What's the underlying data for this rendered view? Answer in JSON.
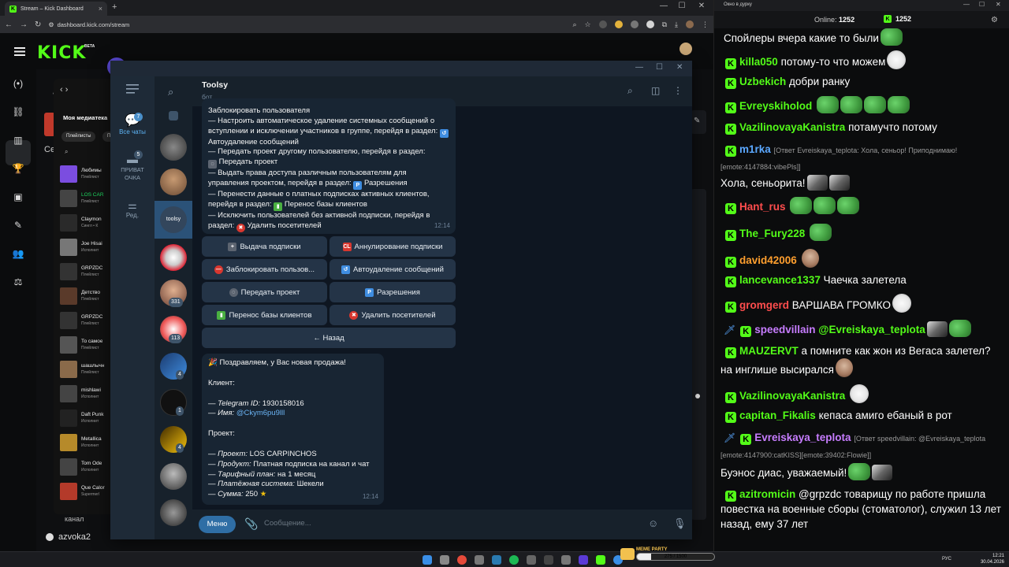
{
  "browser": {
    "tab_title": "Stream – Kick Dashboard",
    "url": "dashboard.kick.com/stream",
    "logo": "KICK",
    "logo_badge": "BETA",
    "bottom_label": "канал",
    "bottom_user": "azvoka2",
    "side_label": "Се"
  },
  "music": {
    "title": "Моя медиатека",
    "chips": [
      "Плейлисты",
      "Плейл"
    ],
    "items": [
      {
        "title": "Любимы",
        "sub": "Плейлист"
      },
      {
        "title": "LOS CAR",
        "sub": "Плейлист"
      },
      {
        "title": "Claymon",
        "sub": "Сингл • К"
      },
      {
        "title": "Joe Hisai",
        "sub": "Исполнит"
      },
      {
        "title": "GRPZDC",
        "sub": "Плейлист"
      },
      {
        "title": "Детство",
        "sub": "Плейлист"
      },
      {
        "title": "GRPZDC",
        "sub": "Плейлист"
      },
      {
        "title": "То самое",
        "sub": "Плейлист"
      },
      {
        "title": "шашлычн",
        "sub": "Плейлист"
      },
      {
        "title": "mishlawi",
        "sub": "Исполнит"
      },
      {
        "title": "Daft Punk",
        "sub": "Исполнит"
      },
      {
        "title": "Metallica",
        "sub": "Исполнит"
      },
      {
        "title": "Tom Ode",
        "sub": "Исполнит"
      },
      {
        "title": "Que Calor",
        "sub": "Supermerl"
      }
    ]
  },
  "telegram": {
    "window_title": "LOS CARPINCHOS",
    "folders": [
      {
        "label": "Все чаты",
        "badge": "7"
      },
      {
        "label": "ПРИВАТ ОЧКА",
        "badge": "5"
      },
      {
        "label": "Ред.",
        "badge": ""
      }
    ],
    "active_chat_label": "toolsy",
    "chat_badges": [
      "331",
      "113",
      "4",
      "1",
      "4"
    ],
    "header": {
      "name": "Toolsy",
      "status": "бот"
    },
    "msg1": {
      "lines": [
        "Заблокировать пользователя",
        "— Настроить автоматическое удаление системных сообщений о вступлении и исключении участников в группе, перейдя в раздел: ",
        "Автоудаление сообщений",
        "— Передать проект другому пользователю, перейдя в раздел:",
        "Передать проект",
        "— Выдать права доступа различным пользователям для управления проектом, перейдя в раздел: ",
        "Разрешения",
        "— Перенести данные о платных подписках активных клиентов, перейдя в раздел: ",
        "Перенос базы клиентов",
        "— Исключить пользователей без активной подписки, перейдя в раздел: ",
        "Удалить посетителей"
      ],
      "time": "12:14"
    },
    "keyboard": {
      "b1": "Выдача подписки",
      "b2": "Аннулирование подписки",
      "b3": "Заблокировать пользов...",
      "b4": "Автоудаление сообщений",
      "b5": "Передать проект",
      "b6": "Разрешения",
      "b7": "Перенос базы клиентов",
      "b8": "Удалить посетителей",
      "back": "← Назад"
    },
    "msg2": {
      "congrats": "Поздравляем, у Вас новая продажа!",
      "client_h": "Клиент:",
      "tg_id_label": "— Telegram ID:",
      "tg_id": "1930158016",
      "name_label": "— Имя:",
      "name": "@Ckym6pu9lll",
      "project_h": "Проект:",
      "project_label": "— Проект:",
      "project": "LOS CARPINCHOS",
      "product_label": "— Продукт:",
      "product": "Платная подписка на канал и чат",
      "plan_label": "— Тарифный план:",
      "plan": "на 1 месяц",
      "pay_label": "— Платёжная система:",
      "pay": "Шекели",
      "sum_label": "— Сумма:",
      "sum": "250",
      "time": "12:14"
    },
    "input": {
      "menu": "Меню",
      "placeholder": "Сообщение..."
    }
  },
  "kick_chat": {
    "window_title": "Окно в дурку",
    "online_label": "Online:",
    "online": "1252",
    "viewers": "1252",
    "messages": [
      {
        "user": "",
        "text": "Спойлеры вчера какие то были"
      },
      {
        "user": "killa050",
        "text": "потому-то что можем"
      },
      {
        "user": "Uzbekich",
        "text": "добри ранку"
      },
      {
        "user": "Evreyskiholod",
        "text": ""
      },
      {
        "user": "VazilinovayaKanistra",
        "text": "потамучто потому"
      },
      {
        "user": "m1rka",
        "reply": "[Ответ Evreiskaya_teplota: Хола, сеньор! Приподнимаю! [emote:4147884:vibePls]]",
        "text": "Хола, сеньорита!"
      },
      {
        "user": "Hant_rus",
        "text": ""
      },
      {
        "user": "The_Fury228",
        "text": ""
      },
      {
        "user": "david42006",
        "text": ""
      },
      {
        "user": "lancevance1337",
        "text": "Чаечка залетела"
      },
      {
        "user": "gromgerd",
        "text": "ВАРШАВА ГРОМКО"
      },
      {
        "user": "speedvillain",
        "text": "@Evreiskaya_teplota"
      },
      {
        "user": "MAUZERVT",
        "text": "а помните как жон из Вегаса залетел? на инглише высирался"
      },
      {
        "user": "VazilinovayaKanistra",
        "text": ""
      },
      {
        "user": "capitan_Fikalis",
        "text": "кепаса амиго ебаный в рот"
      },
      {
        "user": "Evreiskaya_teplota",
        "reply": "[Ответ speedvillain: @Evreiskaya_teplota [emote:4147900:catKISS][emote:39402:Flowie]]",
        "text": "Буэнос диас, уважаемый!"
      },
      {
        "user": "azitromicin",
        "text": "@grpzdc товарищу по работе пришла повестка на военные сборы (стоматолог), служил 13 лет назад, ему 37 лет"
      }
    ]
  },
  "taskbar": {
    "lang": "РУС",
    "time": "12:21",
    "date": "30.04.2026",
    "meme_label": "MEME PARTY",
    "meme_progress": "275 / 1500"
  },
  "colors": {
    "kick_green": "#53fc18",
    "tg_bg": "#0e1621",
    "tg_panel": "#17212b",
    "tg_bubble": "#182533",
    "tg_accent": "#5eb5f7"
  }
}
